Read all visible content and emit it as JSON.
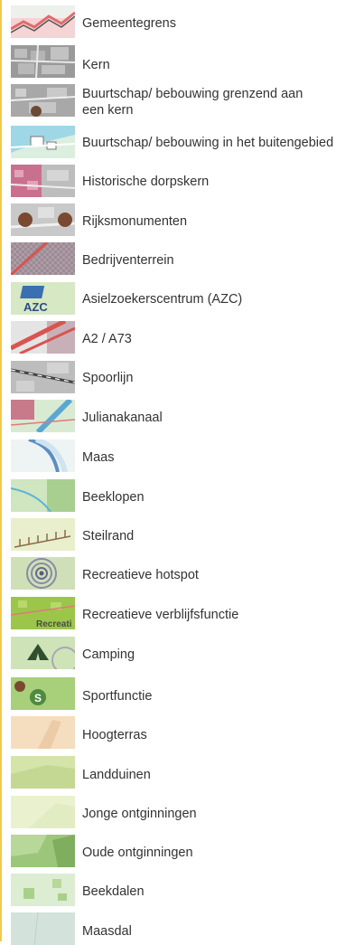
{
  "legend": {
    "items": [
      {
        "id": "gemeentegrens",
        "label": "Gemeentegrens",
        "icon": "municipal-border-swatch-icon",
        "color": "#e07a7a"
      },
      {
        "id": "kern",
        "label": "Kern",
        "icon": "built-up-core-swatch-icon",
        "color": "#9a9a9a"
      },
      {
        "id": "buurtschap-kern",
        "label": "Buurtschap/ bebouwing grenzend aan een kern",
        "label_line1": "Buurtschap/ bebouwing grenzend aan",
        "label_line2": "een kern",
        "icon": "hamlet-near-core-swatch-icon",
        "color": "#b0b0b0"
      },
      {
        "id": "buurtschap-buitengebied",
        "label": "Buurtschap/ bebouwing in het buitengebied",
        "icon": "hamlet-rural-swatch-icon",
        "color": "#7fc7d9"
      },
      {
        "id": "historische-dorpskern",
        "label": "Historische dorpskern",
        "icon": "historic-village-core-swatch-icon",
        "color": "#c96a8a"
      },
      {
        "id": "rijksmonumenten",
        "label": "Rijksmonumenten",
        "icon": "national-monument-swatch-icon",
        "color": "#7a4a30"
      },
      {
        "id": "bedrijventerrein",
        "label": "Bedrijventerrein",
        "icon": "industrial-area-swatch-icon",
        "color": "#a08a96"
      },
      {
        "id": "azc",
        "label": "Asielzoekerscentrum (AZC)",
        "icon": "azc-swatch-icon",
        "color": "#3a6fb0",
        "swatch_text": "AZC"
      },
      {
        "id": "a2-a73",
        "label": "A2 / A73",
        "icon": "motorway-swatch-icon",
        "color": "#d9534f"
      },
      {
        "id": "spoorlijn",
        "label": "Spoorlijn",
        "icon": "railway-swatch-icon",
        "color": "#555555"
      },
      {
        "id": "julianakanaal",
        "label": "Julianakanaal",
        "icon": "canal-swatch-icon",
        "color": "#5ba7d4"
      },
      {
        "id": "maas",
        "label": "Maas",
        "icon": "river-swatch-icon",
        "color": "#5ba7d4"
      },
      {
        "id": "beeklopen",
        "label": "Beeklopen",
        "icon": "brook-swatch-icon",
        "color": "#8fcbe6"
      },
      {
        "id": "steilrand",
        "label": "Steilrand",
        "icon": "escarpment-swatch-icon",
        "color": "#8b6b4a"
      },
      {
        "id": "recreatieve-hotspot",
        "label": "Recreatieve hotspot",
        "icon": "recreation-hotspot-swatch-icon",
        "color": "#7a7a9a"
      },
      {
        "id": "recreatieve-verblijfsfunctie",
        "label": "Recreatieve verblijfsfunctie",
        "icon": "recreational-stay-swatch-icon",
        "color": "#9cc64a",
        "swatch_text": "Recreati"
      },
      {
        "id": "camping",
        "label": "Camping",
        "icon": "tent-swatch-icon",
        "color": "#2f4f2f"
      },
      {
        "id": "sportfunctie",
        "label": "Sportfunctie",
        "icon": "sport-swatch-icon",
        "color": "#5e9b4f",
        "swatch_text": "S"
      },
      {
        "id": "hoogterras",
        "label": "Hoogterras",
        "icon": "high-terrace-swatch-icon",
        "color": "#f3d8b4"
      },
      {
        "id": "landduinen",
        "label": "Landduinen",
        "icon": "inland-dunes-swatch-icon",
        "color": "#d9e6b4"
      },
      {
        "id": "jonge-ontginningen",
        "label": "Jonge ontginningen",
        "icon": "young-reclamation-swatch-icon",
        "color": "#e9f0cc"
      },
      {
        "id": "oude-ontginningen",
        "label": "Oude ontginningen",
        "icon": "old-reclamation-swatch-icon",
        "color": "#8cbb66"
      },
      {
        "id": "beekdalen",
        "label": "Beekdalen",
        "icon": "brook-valley-swatch-icon",
        "color": "#d2e8c8"
      },
      {
        "id": "maasdal",
        "label": "Maasdal",
        "icon": "meuse-valley-swatch-icon",
        "color": "#cfe0d8"
      }
    ]
  }
}
